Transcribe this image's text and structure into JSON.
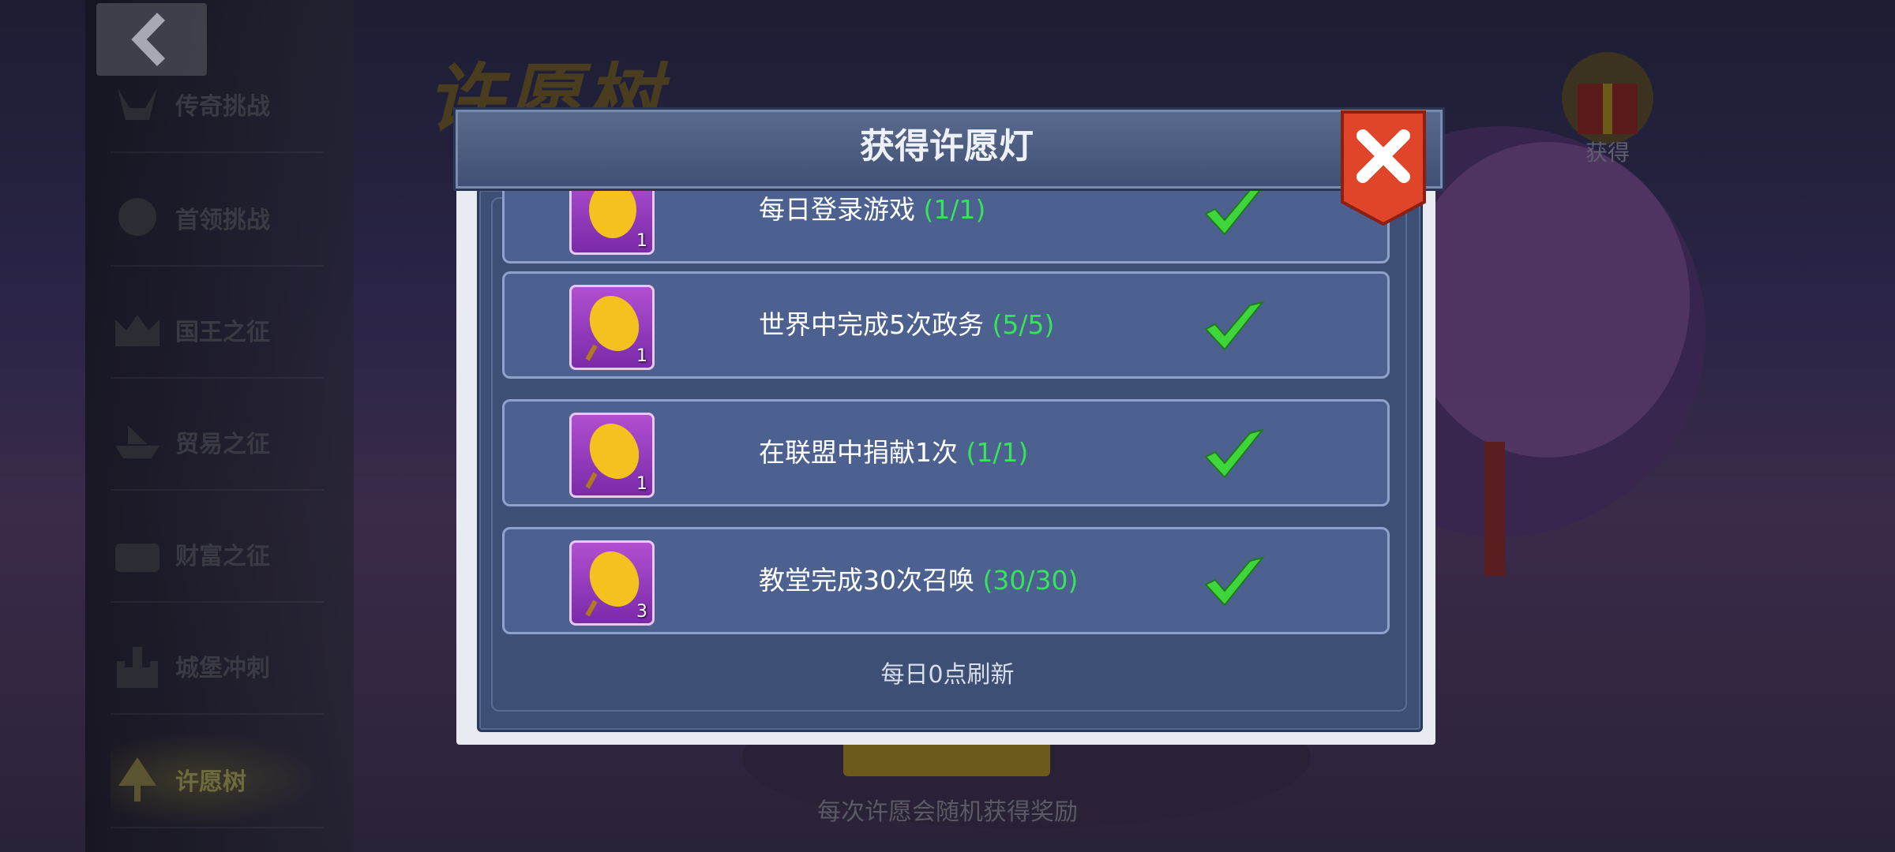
{
  "sidebar": {
    "items": [
      {
        "label": "传奇挑战",
        "icon": "horned-skull-icon"
      },
      {
        "label": "首领挑战",
        "icon": "boss-skull-icon"
      },
      {
        "label": "国王之征",
        "icon": "crown-icon"
      },
      {
        "label": "贸易之征",
        "icon": "trade-ship-icon"
      },
      {
        "label": "财富之征",
        "icon": "treasure-chest-icon"
      },
      {
        "label": "城堡冲刺",
        "icon": "castle-icon"
      },
      {
        "label": "许愿树",
        "icon": "tree-icon",
        "active": true
      }
    ]
  },
  "background": {
    "page_title": "许愿树",
    "gift_label": "获得",
    "wish_hint": "每次许愿会随机获得奖励"
  },
  "dialog": {
    "title": "获得许愿灯",
    "refresh_note": "每日0点刷新",
    "tasks": [
      {
        "name": "每日登录游戏",
        "progress": "(1/1)",
        "reward_count": "1",
        "done": true
      },
      {
        "name": "世界中完成5次政务",
        "progress": "(5/5)",
        "reward_count": "1",
        "done": true
      },
      {
        "name": "在联盟中捐献1次",
        "progress": "(1/1)",
        "reward_count": "1",
        "done": true
      },
      {
        "name": "教堂完成30次召唤",
        "progress": "(30/30)",
        "reward_count": "3",
        "done": true
      }
    ]
  },
  "colors": {
    "progress": "#36e35a",
    "close_button": "#e0452a",
    "lantern_frame": "#9b3fc4"
  }
}
